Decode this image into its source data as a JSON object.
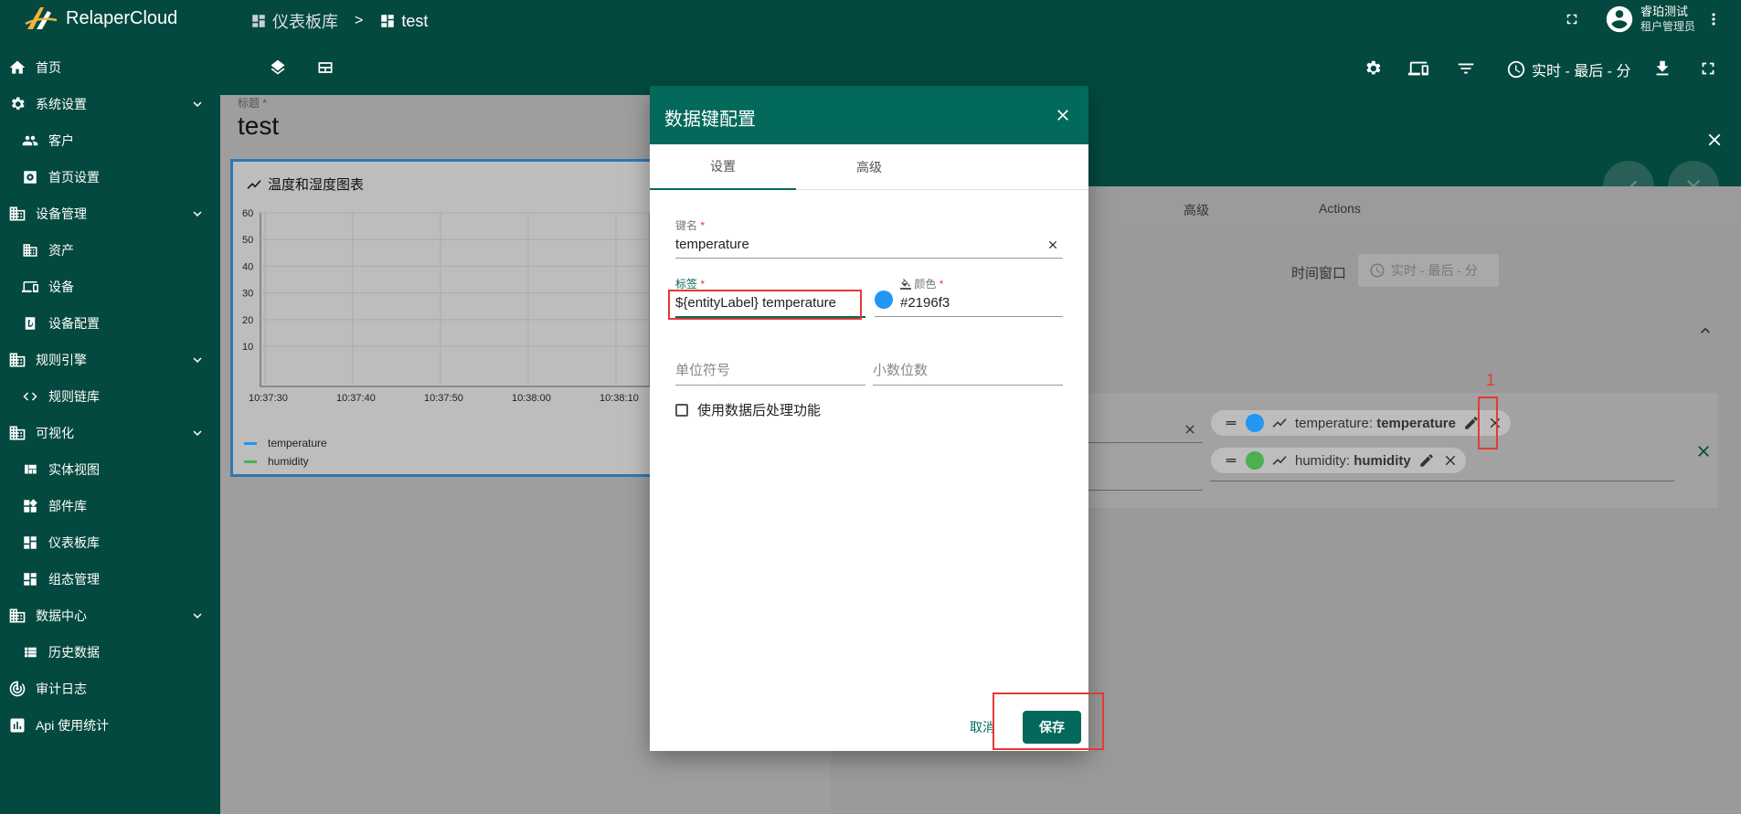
{
  "app": {
    "name": "RelaperCloud"
  },
  "breadcrumb": [
    {
      "label": "仪表板库"
    },
    {
      "separator": ">"
    },
    {
      "label": "test"
    }
  ],
  "user": {
    "name": "睿珀测试",
    "role": "租户管理员"
  },
  "sidebar": {
    "items": [
      {
        "label": "首页",
        "icon": "home-icon"
      },
      {
        "label": "系统设置",
        "icon": "gear-icon",
        "expandable": true
      },
      {
        "label": "客户",
        "icon": "people-icon",
        "sub": true
      },
      {
        "label": "首页设置",
        "icon": "home-settings-icon",
        "sub": true
      },
      {
        "label": "设备管理",
        "icon": "domain-icon",
        "expandable": true
      },
      {
        "label": "资产",
        "icon": "domain-icon",
        "sub": true
      },
      {
        "label": "设备",
        "icon": "devices-icon",
        "sub": true
      },
      {
        "label": "设备配置",
        "icon": "device-profile-icon",
        "sub": true
      },
      {
        "label": "规则引擎",
        "icon": "domain-icon",
        "expandable": true
      },
      {
        "label": "规则链库",
        "icon": "code-icon",
        "sub": true
      },
      {
        "label": "可视化",
        "icon": "domain-icon",
        "expandable": true
      },
      {
        "label": "实体视图",
        "icon": "view-quilt-icon",
        "sub": true
      },
      {
        "label": "部件库",
        "icon": "widgets-icon",
        "sub": true
      },
      {
        "label": "仪表板库",
        "icon": "dashboard-icon",
        "sub": true
      },
      {
        "label": "组态管理",
        "icon": "dashboard-icon",
        "sub": true
      },
      {
        "label": "数据中心",
        "icon": "domain-icon",
        "expandable": true
      },
      {
        "label": "历史数据",
        "icon": "view-list-icon",
        "sub": true
      },
      {
        "label": "审计日志",
        "icon": "track-changes-icon"
      },
      {
        "label": "Api 使用统计",
        "icon": "bar-chart-icon"
      }
    ]
  },
  "toolbar": {
    "time_window": "实时 - 最后 - 分"
  },
  "dashboard": {
    "title_label": "标题 *",
    "title": "test"
  },
  "widget": {
    "title": "温度和湿度图表",
    "y_ticks": [
      "60",
      "50",
      "40",
      "30",
      "20",
      "10"
    ],
    "x_ticks": [
      "10:37:30",
      "10:37:40",
      "10:37:50",
      "10:38:00",
      "10:38:10"
    ],
    "legend": [
      {
        "name": "temperature",
        "color": "#2196f3"
      },
      {
        "name": "humidity",
        "color": "#4caf50"
      }
    ]
  },
  "right_panel": {
    "tabs": [
      {
        "label": "高级"
      },
      {
        "label": "Actions"
      }
    ],
    "time_window_label": "时间窗口",
    "time_window_value": "实时 - 最后 - 分",
    "chips": [
      {
        "key": "temperature: ",
        "label": "temperature",
        "color": "#2196f3"
      },
      {
        "key": "humidity: ",
        "label": "humidity",
        "color": "#4caf50"
      }
    ],
    "annotation_number": "1"
  },
  "dialog": {
    "title": "数据键配置",
    "tabs": [
      {
        "label": "设置"
      },
      {
        "label": "高级"
      }
    ],
    "key_name": {
      "label": "键名",
      "value": "temperature"
    },
    "label": {
      "label": "标签",
      "value": "${entityLabel} temperature"
    },
    "color": {
      "label": "颜色",
      "value": "#2196f3",
      "display": "#2196f3"
    },
    "units": {
      "placeholder": "单位符号"
    },
    "decimals": {
      "placeholder": "小数位数"
    },
    "postprocess": {
      "label": "使用数据后处理功能",
      "checked": false
    },
    "cancel_label": "取消",
    "save_label": "保存"
  },
  "colors": {
    "primary": "#03493f",
    "accent": "#03695a",
    "annotation": "#e53935"
  }
}
